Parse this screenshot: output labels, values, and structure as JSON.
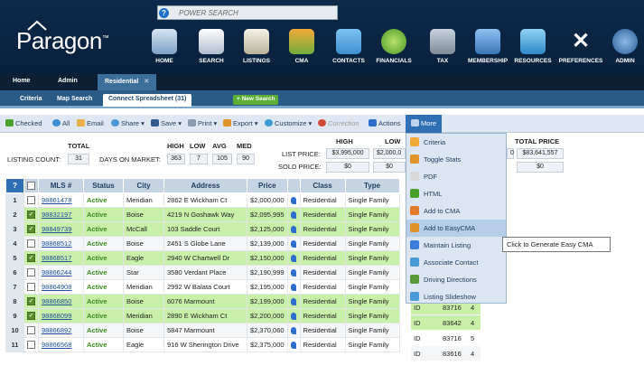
{
  "search": {
    "placeholder": "POWER SEARCH"
  },
  "brand": {
    "logo": "Paragon",
    "tm": "™"
  },
  "nav": [
    {
      "label": "HOME",
      "icon": "home-icon"
    },
    {
      "label": "SEARCH",
      "icon": "search-icon"
    },
    {
      "label": "LISTINGS",
      "icon": "listings-icon"
    },
    {
      "label": "CMA",
      "icon": "cma-icon"
    },
    {
      "label": "CONTACTS",
      "icon": "contacts-icon"
    },
    {
      "label": "FINANCIALS",
      "icon": "financials-icon"
    },
    {
      "label": "TAX",
      "icon": "tax-icon"
    },
    {
      "label": "MEMBERSHIP",
      "icon": "membership-icon"
    },
    {
      "label": "RESOURCES",
      "icon": "resources-icon"
    },
    {
      "label": "PREFERENCES",
      "icon": "preferences-icon"
    },
    {
      "label": "ADMIN",
      "icon": "admin-icon"
    }
  ],
  "subnav": {
    "home": "Home",
    "admin": "Admin",
    "residential": "Residential",
    "close": "✕"
  },
  "tabs": {
    "criteria": "Criteria",
    "map_search": "Map Search",
    "connect": "Connect Spreadsheet (31)",
    "new_search": "+ New Search"
  },
  "toolbar": {
    "checked": "Checked",
    "all": "All",
    "email": "Email",
    "share": "Share",
    "save": "Save",
    "print": "Print",
    "export": "Export",
    "customize": "Customize",
    "correction": "Correction",
    "actions": "Actions",
    "more": "More"
  },
  "stats": {
    "total_label": "TOTAL",
    "listing_count_label": "LISTING COUNT:",
    "listing_count": "31",
    "high_label": "HIGH",
    "low_label": "LOW",
    "avg_label": "AVG",
    "med_label": "MED",
    "dom_label": "DAYS ON MARKET:",
    "dom_high": "363",
    "dom_low": "7",
    "dom_avg": "105",
    "dom_med": "90",
    "price_high_label": "HIGH",
    "price_low_label": "LOW",
    "list_price_label": "LIST PRICE:",
    "list_high": "$3,995,000",
    "list_low": "$2,000,0",
    "sold_price_label": "SOLD PRICE:",
    "sold_high": "$0",
    "sold_low": "$0",
    "total_price_label": "TOTAL PRICE",
    "total_list": "$83,641,557",
    "total_sold": "$0",
    "partial": "0"
  },
  "table": {
    "headers": [
      "?",
      "",
      "MLS #",
      "Status",
      "City",
      "Address",
      "Price",
      "",
      "Class",
      "Type"
    ],
    "rows": [
      {
        "n": "1",
        "checked": false,
        "mls": "98861478",
        "status": "Active",
        "city": "Meridian",
        "address": "2862 E Wickham Ct",
        "price": "$2,000,000",
        "cls": "Residential",
        "type": "Single Family"
      },
      {
        "n": "2",
        "checked": true,
        "mls": "98832197",
        "status": "Active",
        "city": "Boise",
        "address": "4219 N Goshawk Way",
        "price": "$2,095,995",
        "cls": "Residential",
        "type": "Single Family"
      },
      {
        "n": "3",
        "checked": true,
        "mls": "98849739",
        "status": "Active",
        "city": "McCall",
        "address": "103 Saddle Court",
        "price": "$2,125,000",
        "cls": "Residential",
        "type": "Single Family"
      },
      {
        "n": "4",
        "checked": false,
        "mls": "98868512",
        "status": "Active",
        "city": "Boise",
        "address": "2451 S Globe Lane",
        "price": "$2,139,000",
        "cls": "Residential",
        "type": "Single Family"
      },
      {
        "n": "5",
        "checked": true,
        "mls": "98868517",
        "status": "Active",
        "city": "Eagle",
        "address": "2940 W Chartwell Dr",
        "price": "$2,150,000",
        "cls": "Residential",
        "type": "Single Family"
      },
      {
        "n": "6",
        "checked": false,
        "mls": "98866244",
        "status": "Active",
        "city": "Star",
        "address": "3580 Verdant Place",
        "price": "$2,190,999",
        "cls": "Residential",
        "type": "Single Family"
      },
      {
        "n": "7",
        "checked": false,
        "mls": "98864908",
        "status": "Active",
        "city": "Meridian",
        "address": "2992 W Balata Court",
        "price": "$2,195,000",
        "cls": "Residential",
        "type": "Single Family"
      },
      {
        "n": "8",
        "checked": true,
        "mls": "98866850",
        "status": "Active",
        "city": "Boise",
        "address": "6076 Marmount",
        "price": "$2,199,000",
        "cls": "Residential",
        "type": "Single Family"
      },
      {
        "n": "9",
        "checked": true,
        "mls": "98868099",
        "status": "Active",
        "city": "Meridian",
        "address": "2890 E Wickham Ct",
        "price": "$2,200,000",
        "cls": "Residential",
        "type": "Single Family"
      },
      {
        "n": "10",
        "checked": false,
        "mls": "98866892",
        "status": "Active",
        "city": "Boise",
        "address": "5847 Marmount",
        "price": "$2,370,060",
        "cls": "Residential",
        "type": "Single Family"
      },
      {
        "n": "11",
        "checked": false,
        "mls": "98866568",
        "status": "Active",
        "city": "Eagle",
        "address": "916 W Sherington Drive",
        "price": "$2,375,000",
        "cls": "Residential",
        "type": "Single Family"
      }
    ],
    "extra_rows": [
      {
        "state": "ID",
        "zip": "83716",
        "beds": "4"
      },
      {
        "state": "ID",
        "zip": "83642",
        "beds": "4"
      },
      {
        "state": "ID",
        "zip": "83716",
        "beds": "5"
      },
      {
        "state": "ID",
        "zip": "83616",
        "beds": "4"
      }
    ]
  },
  "menu": [
    {
      "label": "Criteria",
      "icon": "criteria-icon"
    },
    {
      "label": "Toggle Stats",
      "icon": "toggle-stats-icon"
    },
    {
      "label": "PDF",
      "icon": "pdf-icon"
    },
    {
      "label": "HTML",
      "icon": "html-icon"
    },
    {
      "label": "Add to CMA",
      "icon": "add-cma-icon"
    },
    {
      "label": "Add to EasyCMA",
      "icon": "add-easycma-icon"
    },
    {
      "label": "Maintain Listing",
      "icon": "maintain-listing-icon"
    },
    {
      "label": "Associate Contact",
      "icon": "associate-contact-icon"
    },
    {
      "label": "Driving Directions",
      "icon": "driving-directions-icon"
    },
    {
      "label": "Listing Slideshow",
      "icon": "slideshow-icon"
    }
  ],
  "tooltip": "Click to Generate Easy CMA"
}
